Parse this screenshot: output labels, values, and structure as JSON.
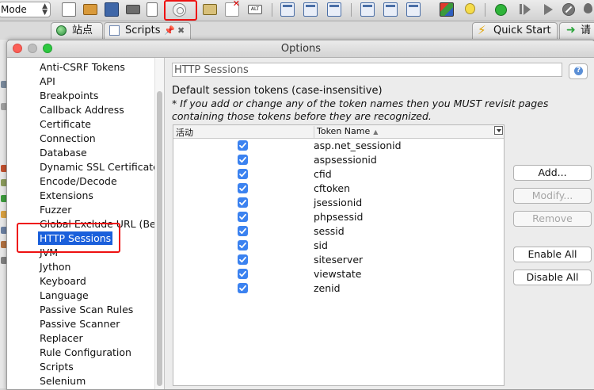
{
  "toolbar": {
    "mode_value": "Mode"
  },
  "tabs": [
    {
      "label": "站点"
    },
    {
      "label": "Scripts"
    },
    {
      "label": "Quick Start"
    },
    {
      "label": "请"
    }
  ],
  "dialog": {
    "title": "Options",
    "tree_items": [
      "Anti-CSRF Tokens",
      "API",
      "Breakpoints",
      "Callback Address",
      "Certificate",
      "Connection",
      "Database",
      "Dynamic SSL Certificates",
      "Encode/Decode",
      "Extensions",
      "Fuzzer",
      "Global Exclude URL (Beta",
      "HTTP Sessions",
      "JVM",
      "Jython",
      "Keyboard",
      "Language",
      "Passive Scan Rules",
      "Passive Scanner",
      "Replacer",
      "Rule Configuration",
      "Scripts",
      "Selenium"
    ],
    "selected_tree_item": "HTTP Sessions",
    "section_title": "HTTP Sessions",
    "description": "Default session tokens (case-insensitive)",
    "warning": "* If you add or change any of the token names then you MUST revisit pages containing those tokens before they are recognized.",
    "table": {
      "col_active": "活动",
      "col_name": "Token Name",
      "rows": [
        {
          "name": "asp.net_sessionid",
          "active": true
        },
        {
          "name": "aspsessionid",
          "active": true
        },
        {
          "name": "cfid",
          "active": true
        },
        {
          "name": "cftoken",
          "active": true
        },
        {
          "name": "jsessionid",
          "active": true
        },
        {
          "name": "phpsessid",
          "active": true
        },
        {
          "name": "sessid",
          "active": true
        },
        {
          "name": "sid",
          "active": true
        },
        {
          "name": "siteserver",
          "active": true
        },
        {
          "name": "viewstate",
          "active": true
        },
        {
          "name": "zenid",
          "active": true
        }
      ]
    },
    "buttons": {
      "add": "Add...",
      "modify": "Modify...",
      "remove": "Remove",
      "enable_all": "Enable All",
      "disable_all": "Disable All"
    }
  },
  "colors": {
    "selection": "#1a5fdb",
    "checkbox": "#3b82f0",
    "highlight_box": "#ee1111"
  }
}
